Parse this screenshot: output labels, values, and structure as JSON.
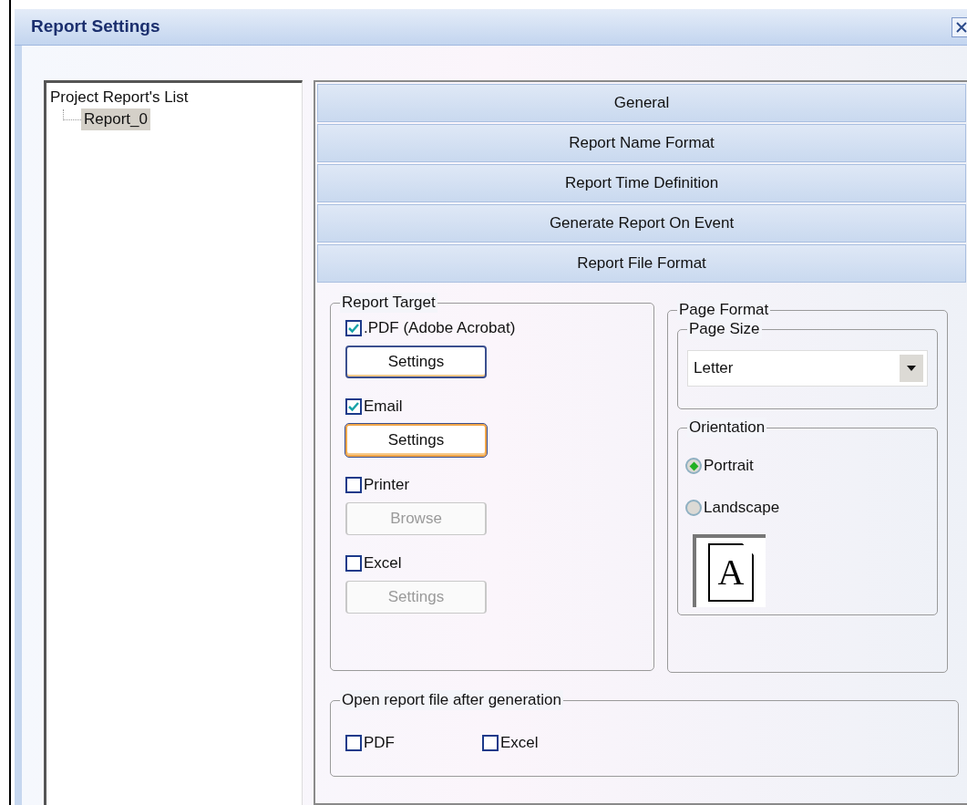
{
  "window": {
    "title": "Report Settings"
  },
  "tree": {
    "root": "Project Report's List",
    "children": [
      {
        "label": "Report_0",
        "selected": true
      }
    ]
  },
  "sections": [
    "General",
    "Report Name Format",
    "Report Time Definition",
    "Generate Report On Event",
    "Report File Format"
  ],
  "report_target": {
    "title": "Report Target",
    "items": [
      {
        "label": ".PDF (Adobe Acrobat)",
        "checked": true,
        "button": {
          "label": "Settings",
          "disabled": false,
          "focused": false
        }
      },
      {
        "label": "Email",
        "checked": true,
        "button": {
          "label": "Settings",
          "disabled": false,
          "focused": true
        }
      },
      {
        "label": "Printer",
        "checked": false,
        "button": {
          "label": "Browse",
          "disabled": true,
          "focused": false
        }
      },
      {
        "label": "Excel",
        "checked": false,
        "button": {
          "label": "Settings",
          "disabled": true,
          "focused": false
        }
      }
    ]
  },
  "page_format": {
    "title": "Page Format",
    "page_size": {
      "title": "Page Size",
      "value": "Letter"
    },
    "orientation": {
      "title": "Orientation",
      "options": [
        {
          "label": "Portrait",
          "selected": true
        },
        {
          "label": "Landscape",
          "selected": false
        }
      ],
      "preview": "A"
    }
  },
  "open_after": {
    "title": "Open report file after generation",
    "items": [
      {
        "label": "PDF",
        "checked": false
      },
      {
        "label": "Excel",
        "checked": false
      }
    ]
  }
}
